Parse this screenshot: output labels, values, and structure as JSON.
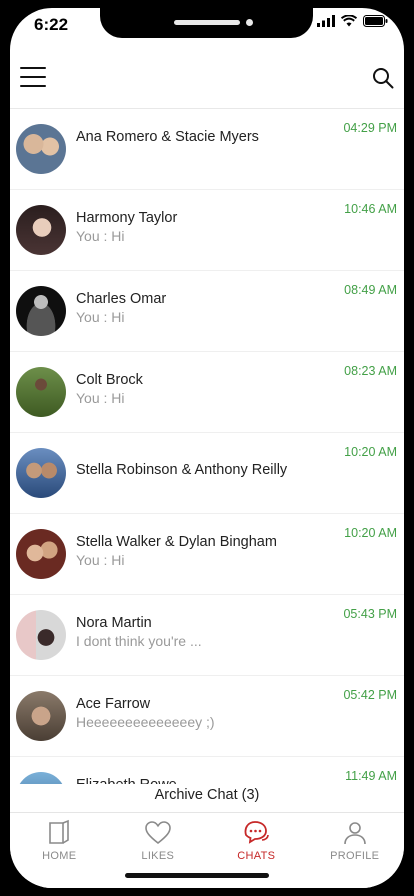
{
  "status_bar": {
    "time": "6:22"
  },
  "chats": [
    {
      "name": "Ana Romero & Stacie Myers",
      "message": "",
      "time": "04:29 PM",
      "avatar_color": "#6b7f9a"
    },
    {
      "name": "Harmony Taylor",
      "message": "You : Hi",
      "time": "10:46 AM",
      "avatar_color": "#3a2a2a"
    },
    {
      "name": "Charles Omar",
      "message": "You : Hi",
      "time": "08:49 AM",
      "avatar_color": "#1c1c1c"
    },
    {
      "name": "Colt Brock",
      "message": "You : Hi",
      "time": "08:23 AM",
      "avatar_color": "#4a6b2a"
    },
    {
      "name": "Stella Robinson & Anthony Reilly",
      "message": "",
      "time": "10:20 AM",
      "avatar_color": "#3d5a8a"
    },
    {
      "name": "Stella Walker & Dylan Bingham",
      "message": "You : Hi",
      "time": "10:20 AM",
      "avatar_color": "#8a4a3a"
    },
    {
      "name": "Nora Martin",
      "message": "I dont think you're ...",
      "time": "05:43 PM",
      "avatar_color": "#c9a9a9"
    },
    {
      "name": "Ace Farrow",
      "message": "Heeeeeeeeeeeeeey ;)",
      "time": "05:42 PM",
      "avatar_color": "#7a6a5a"
    },
    {
      "name": "Elizabeth Rowe",
      "message": "",
      "time": "11:49 AM",
      "avatar_color": "#5a8ab0"
    }
  ],
  "archive": {
    "label": "Archive Chat (3)"
  },
  "tabs": [
    {
      "label": "HOME",
      "icon": "home-icon"
    },
    {
      "label": "LIKES",
      "icon": "heart-icon"
    },
    {
      "label": "CHATS",
      "icon": "chat-bubbles-icon",
      "active": true
    },
    {
      "label": "PROFILE",
      "icon": "profile-icon"
    }
  ],
  "colors": {
    "accent": "#c62828",
    "time_green": "#43a047"
  }
}
